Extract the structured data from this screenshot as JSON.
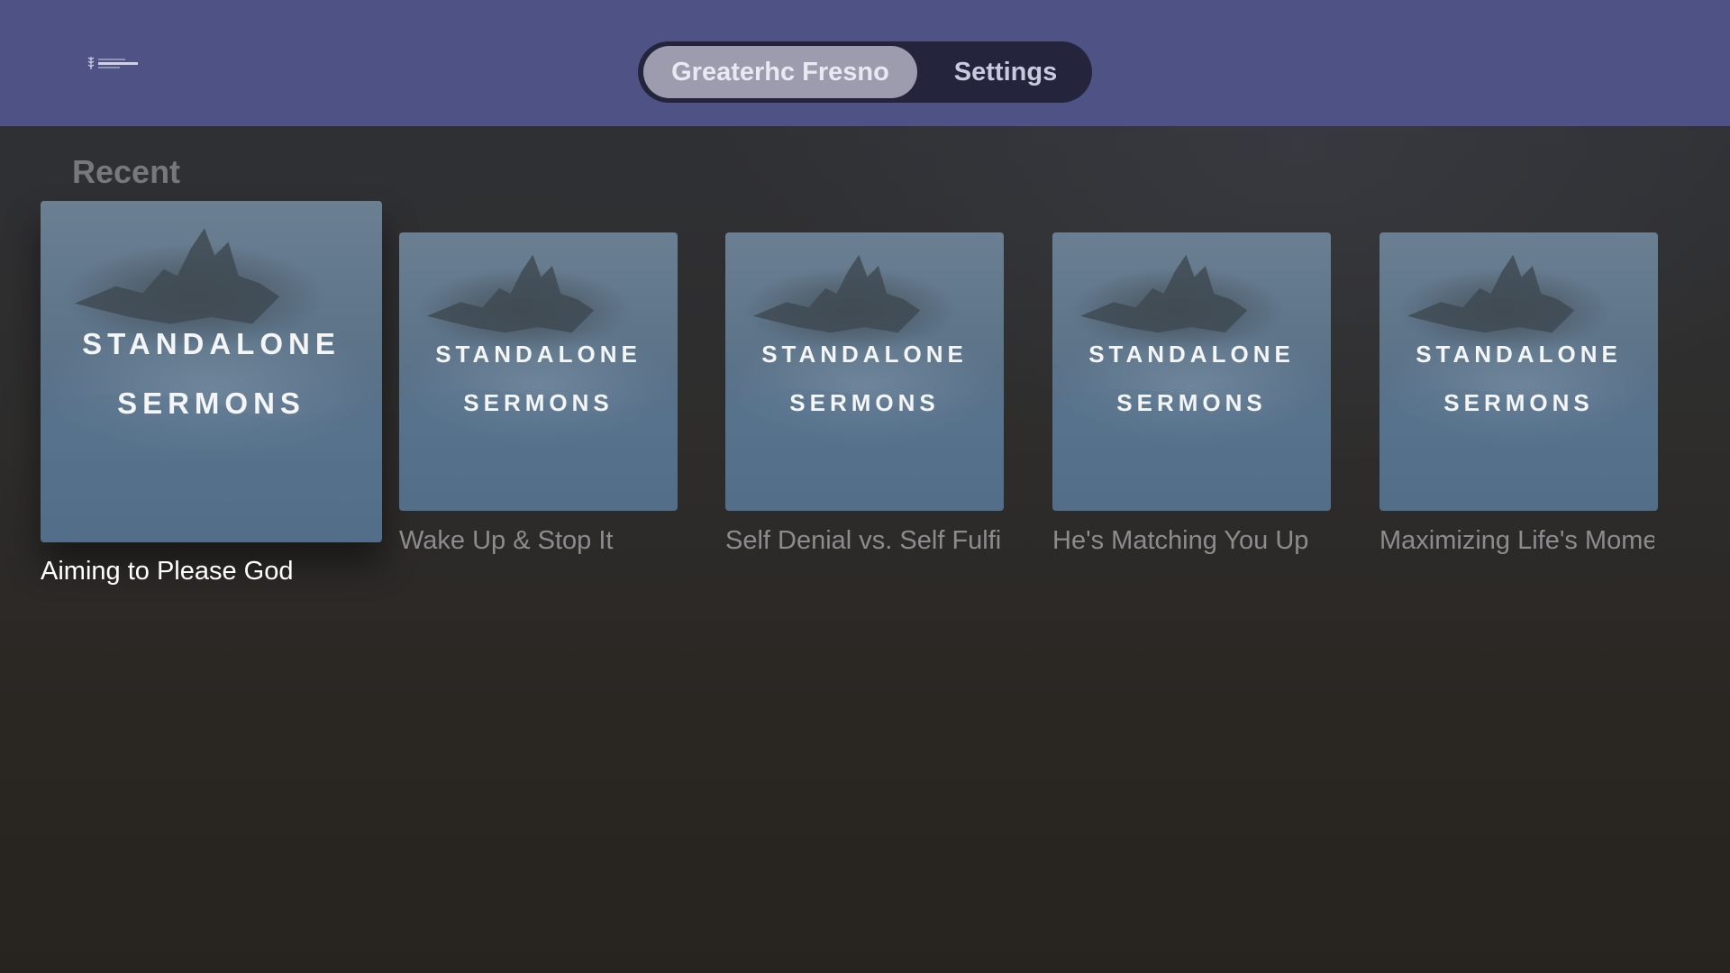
{
  "header": {
    "logo_icon": "harvest-church-logo",
    "tabs": [
      {
        "label": "Greaterhc Fresno",
        "selected": true
      },
      {
        "label": "Settings",
        "selected": false
      }
    ]
  },
  "section": {
    "title": "Recent"
  },
  "artwork_text": {
    "line1": "STANDALONE",
    "line2": "SERMONS"
  },
  "items": [
    {
      "title": "Aiming to Please God",
      "focused": true
    },
    {
      "title": "Wake Up & Stop It",
      "focused": false
    },
    {
      "title": "Self Denial vs. Self Fulfillment",
      "focused": false
    },
    {
      "title": "He's Matching You Up",
      "focused": false
    },
    {
      "title": "Maximizing Life's Moments",
      "focused": false
    }
  ],
  "colors": {
    "header_bg": "#4e5284",
    "tab_selected_bg": "#9c9cae",
    "tab_bar_bg": "#24243c"
  }
}
